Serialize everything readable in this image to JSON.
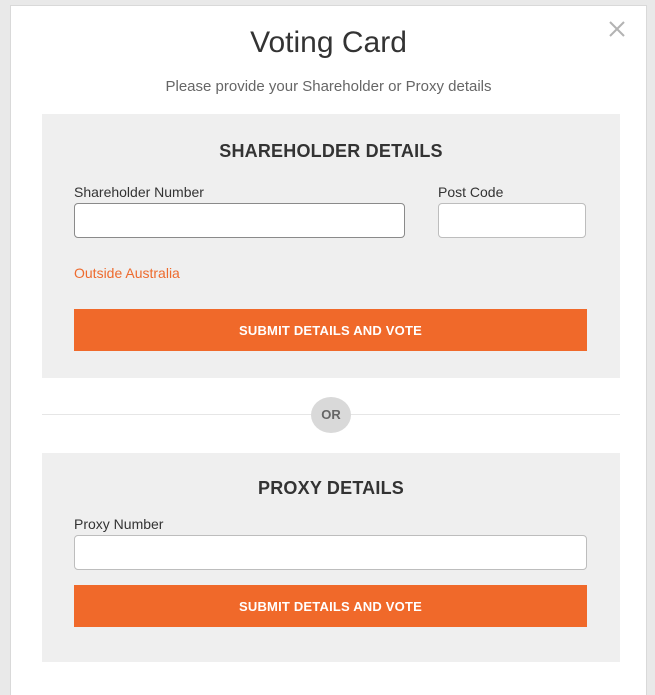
{
  "modal": {
    "title": "Voting Card",
    "subtitle": "Please provide your Shareholder or Proxy details",
    "close_icon": "close-icon"
  },
  "shareholder": {
    "heading": "SHAREHOLDER DETAILS",
    "number_label": "Shareholder Number",
    "number_value": "",
    "postcode_label": "Post Code",
    "postcode_value": "",
    "outside_link": "Outside Australia",
    "submit_label": "SUBMIT DETAILS AND VOTE"
  },
  "divider": {
    "label": "OR"
  },
  "proxy": {
    "heading": "PROXY DETAILS",
    "number_label": "Proxy Number",
    "number_value": "",
    "submit_label": "SUBMIT DETAILS AND VOTE"
  },
  "colors": {
    "accent": "#f0692a",
    "link": "#ee6b2e",
    "panel_bg": "#efefef",
    "or_badge_bg": "#d9d9d9"
  }
}
